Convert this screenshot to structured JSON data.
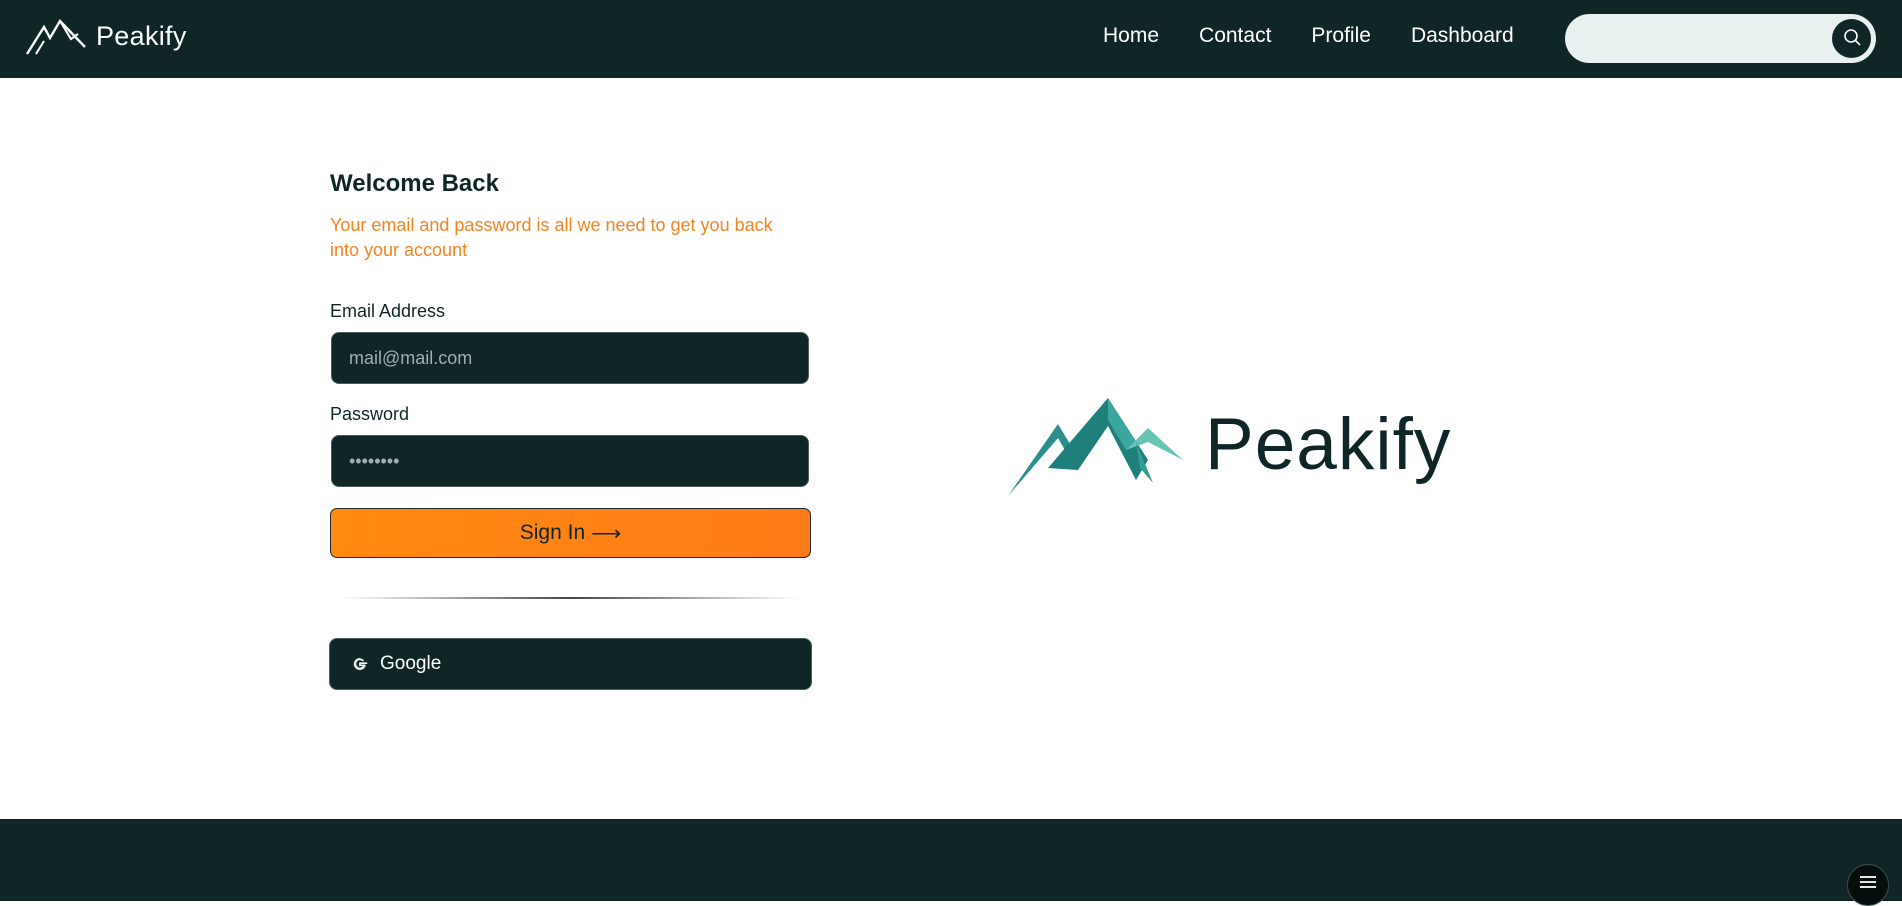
{
  "brand": {
    "name": "Peakify",
    "icon": "mountain-logo-icon"
  },
  "nav": {
    "links": [
      {
        "label": "Home"
      },
      {
        "label": "Contact"
      },
      {
        "label": "Profile"
      },
      {
        "label": "Dashboard"
      }
    ]
  },
  "search": {
    "placeholder": "",
    "value": "",
    "icon": "search-icon"
  },
  "login": {
    "title": "Welcome Back",
    "subtitle": "Your email and password is all we need to get you back into your account",
    "email_label": "Email Address",
    "email_placeholder": "mail@mail.com",
    "password_label": "Password",
    "password_placeholder": "••••••••",
    "signin_label": "Sign In",
    "signin_arrow": "⟶",
    "google_label": "Google",
    "google_icon": "google-icon"
  },
  "hero_logo": {
    "name": "Peakify",
    "icon": "mountain-logo-icon"
  },
  "footer": {
    "menu_icon": "hamburger-menu-icon"
  },
  "colors": {
    "dark": "#102626",
    "accent_orange": "#f4821f",
    "button_orange": "#ff8a10",
    "teal": "#2f9d94",
    "search_bg": "#e9f1f0"
  }
}
